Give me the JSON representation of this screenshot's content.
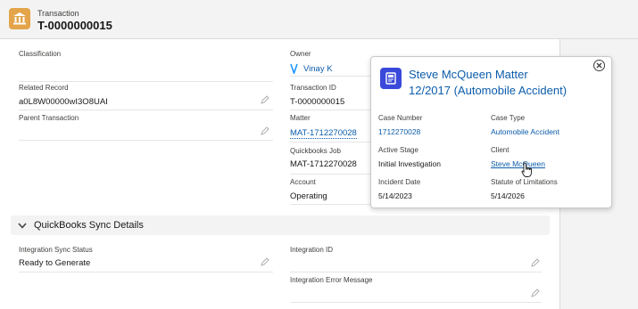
{
  "header": {
    "eyebrow": "Transaction",
    "title": "T-0000000015",
    "icon": "bank-icon"
  },
  "fields": {
    "classification": {
      "label": "Classification",
      "value": ""
    },
    "owner": {
      "label": "Owner",
      "value": "Vinay K"
    },
    "related_record": {
      "label": "Related Record",
      "value": "a0L8W00000wI3O8UAI"
    },
    "transaction_id": {
      "label": "Transaction ID",
      "value": "T-0000000015"
    },
    "parent_transaction": {
      "label": "Parent Transaction",
      "value": ""
    },
    "matter": {
      "label": "Matter",
      "value": "MAT-1712270028"
    },
    "quickbooks_job": {
      "label": "Quickbooks Job",
      "value": "MAT-1712270028"
    },
    "account": {
      "label": "Account",
      "value": "Operating"
    }
  },
  "section": {
    "title": "QuickBooks Sync Details",
    "fields": {
      "integration_sync_status": {
        "label": "Integration Sync Status",
        "value": "Ready to Generate"
      },
      "integration_id": {
        "label": "Integration ID",
        "value": ""
      },
      "integration_error_message": {
        "label": "Integration Error Message",
        "value": ""
      }
    }
  },
  "popover": {
    "title_line1": "Steve McQueen Matter",
    "title_line2": "12/2017 (Automobile Accident)",
    "case_number": {
      "label": "Case Number",
      "value": "1712270028"
    },
    "case_type": {
      "label": "Case Type",
      "value": "Automobile Accident"
    },
    "active_stage": {
      "label": "Active Stage",
      "value": "Initial Investigation"
    },
    "client": {
      "label": "Client",
      "value": "Steve McQueen"
    },
    "incident_date": {
      "label": "Incident Date",
      "value": "5/14/2023"
    },
    "statute_of_limitations": {
      "label": "Statute of Limitations",
      "value": "5/14/2026"
    }
  },
  "colors": {
    "link": "#0b5cab",
    "header_icon": "#e3a44a",
    "popover_icon": "#3a49da"
  }
}
